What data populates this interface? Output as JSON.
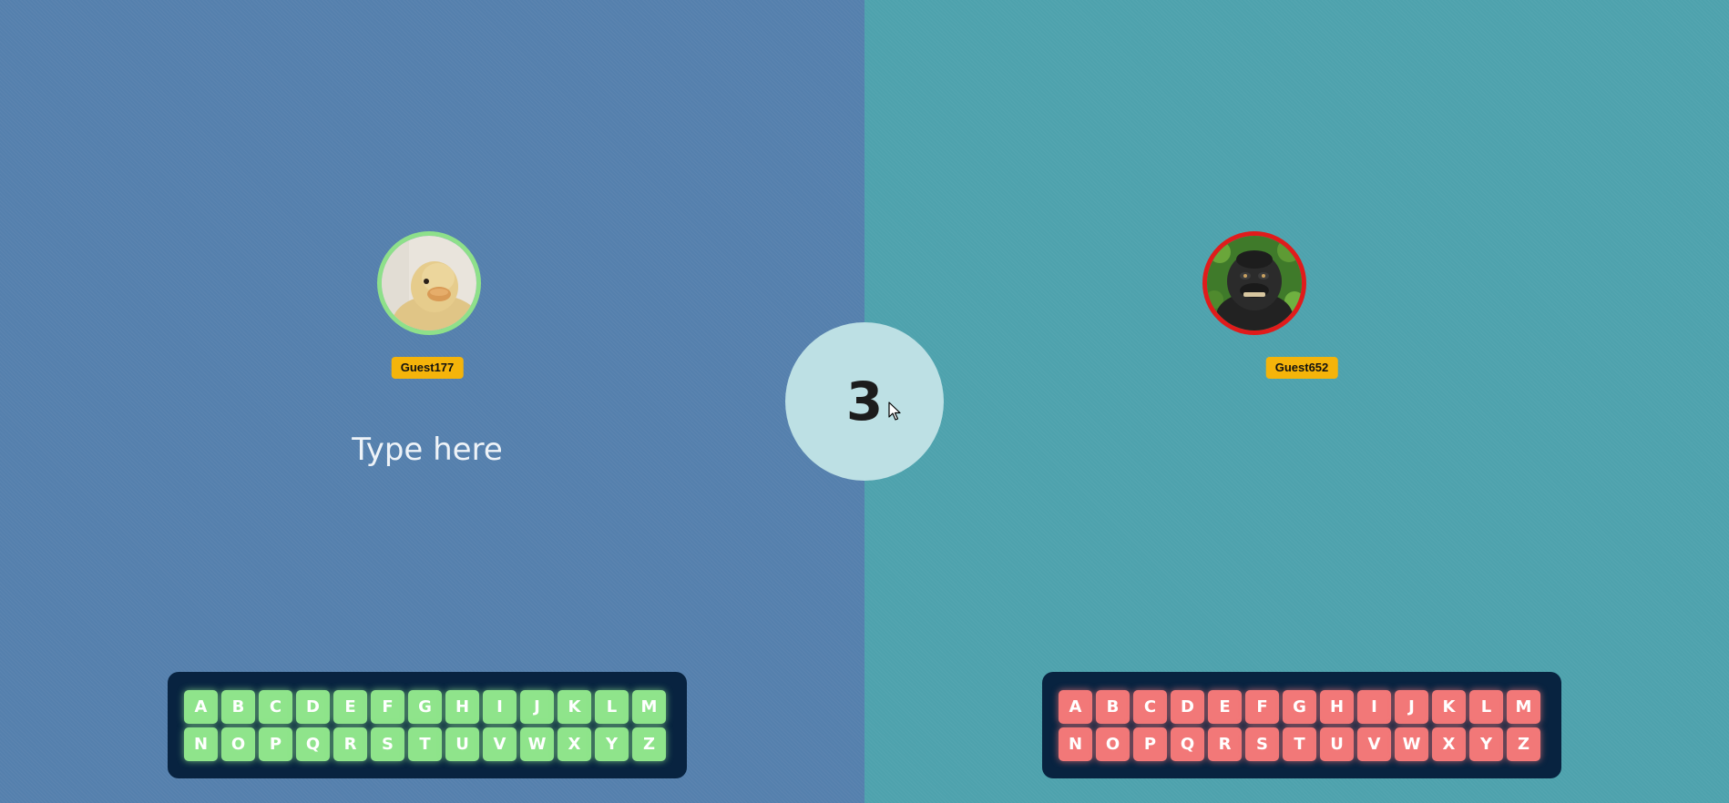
{
  "game": {
    "countdown": "3"
  },
  "player_left": {
    "name": "Guest177",
    "avatar": "duckling-photo",
    "ring_color": "#8ee08a",
    "input_placeholder": "Type here",
    "key_color": "#8fe48b",
    "keyboard_rows": [
      [
        "A",
        "B",
        "C",
        "D",
        "E",
        "F",
        "G",
        "H",
        "I",
        "J",
        "K",
        "L",
        "M"
      ],
      [
        "N",
        "O",
        "P",
        "Q",
        "R",
        "S",
        "T",
        "U",
        "V",
        "W",
        "X",
        "Y",
        "Z"
      ]
    ]
  },
  "player_right": {
    "name": "Guest652",
    "avatar": "monkey-selfie-photo",
    "ring_color": "#e01b1b",
    "key_color": "#f27878",
    "keyboard_rows": [
      [
        "A",
        "B",
        "C",
        "D",
        "E",
        "F",
        "G",
        "H",
        "I",
        "J",
        "K",
        "L",
        "M"
      ],
      [
        "N",
        "O",
        "P",
        "Q",
        "R",
        "S",
        "T",
        "U",
        "V",
        "W",
        "X",
        "Y",
        "Z"
      ]
    ]
  },
  "colors": {
    "left_background": "#5580ad",
    "right_background": "#4ea2ad",
    "badge": "#f5b40a",
    "keyboard_panel": "#082340",
    "countdown_circle": "#bde0e4"
  }
}
